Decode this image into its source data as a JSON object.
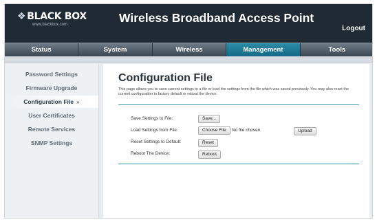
{
  "brand": {
    "logo_text": "BLACK BOX",
    "logo_sub": "www.blackbox.com"
  },
  "header": {
    "title": "Wireless Broadband Access Point",
    "logout_label": "Logout"
  },
  "nav": {
    "items": [
      "Status",
      "System",
      "Wireless",
      "Management",
      "Tools"
    ],
    "active": "Management"
  },
  "sidebar": {
    "items": [
      "Password Settings",
      "Firmware Upgrade",
      "Configuration File",
      "User Certificates",
      "Remote Services",
      "SNMP Settings"
    ],
    "active": "Configuration File",
    "active_indicator": "»"
  },
  "main": {
    "title": "Configuration File",
    "description": "This page allows you to save current settings to a file or load the settings from the file which was saved previously. You may also reset the current configuration to factory default or reboot the device.",
    "rows": [
      {
        "label": "Save Settings to File:",
        "button": "Save..."
      },
      {
        "label": "Load Settings from File:",
        "button": "Choose File",
        "file_status": "No file chosen",
        "upload_button": "Upload"
      },
      {
        "label": "Reset Settings to Default:",
        "button": "Reset"
      },
      {
        "label": "Reboot The Device:",
        "button": "Reboot"
      }
    ]
  },
  "colors": {
    "header_bg": "#1f2a35",
    "accent": "#1a7c98",
    "rule": "#2b93aa"
  }
}
